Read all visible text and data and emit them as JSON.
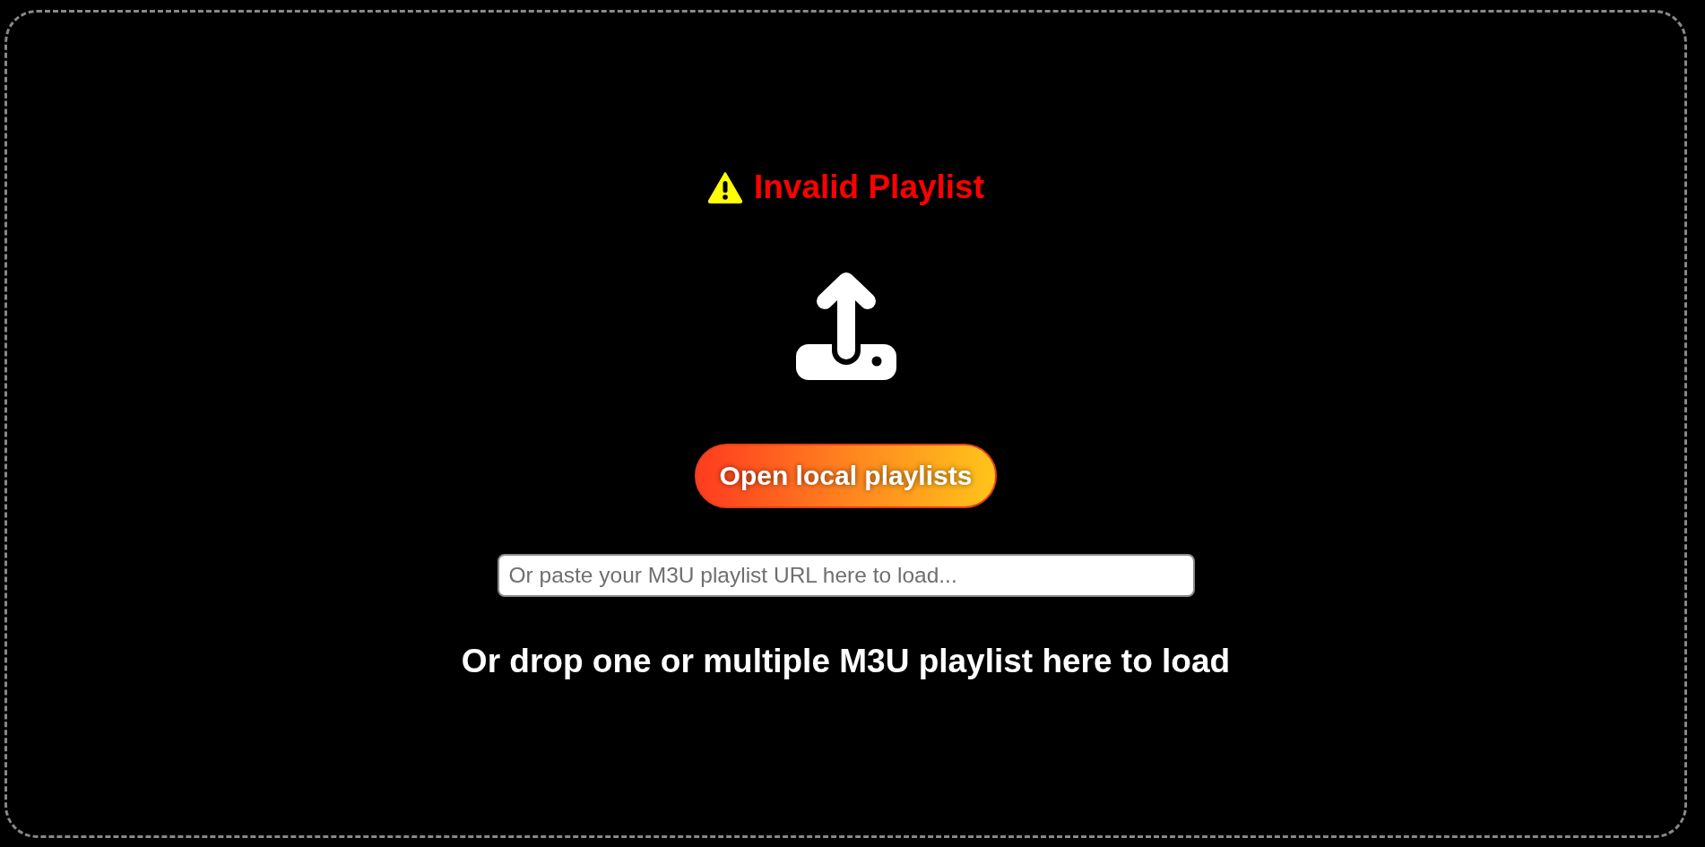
{
  "error": {
    "message": "Invalid Playlist"
  },
  "open_button": {
    "label": "Open local playlists"
  },
  "url_field": {
    "placeholder": "Or paste your M3U playlist URL here to load..."
  },
  "drop_hint": "Or drop one or multiple M3U playlist here to load"
}
